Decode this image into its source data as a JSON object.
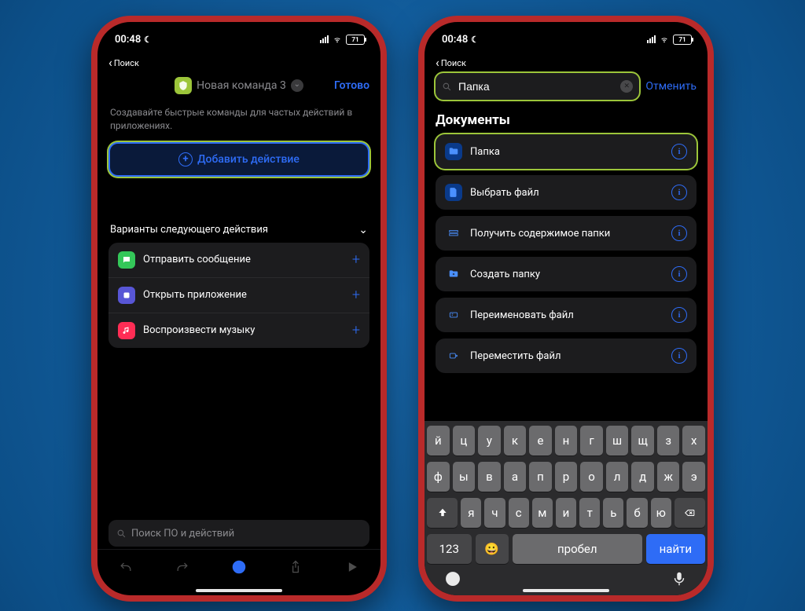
{
  "status": {
    "time": "00:48",
    "back": "Поиск",
    "battery": "71"
  },
  "left": {
    "shortcut_name": "Новая команда 3",
    "done": "Готово",
    "desc": "Создавайте быстрые команды для частых действий в приложениях.",
    "add_action": "Добавить действие",
    "next_variants": "Варианты следующего действия",
    "suggestions": [
      {
        "label": "Отправить сообщение"
      },
      {
        "label": "Открыть приложение"
      },
      {
        "label": "Воспроизвести музыку"
      }
    ],
    "search_placeholder": "Поиск ПО и действий"
  },
  "right": {
    "search_value": "Папка",
    "cancel": "Отменить",
    "section": "Документы",
    "results": [
      {
        "label": "Папка"
      },
      {
        "label": "Выбрать файл"
      },
      {
        "label": "Получить содержимое папки"
      },
      {
        "label": "Создать папку"
      },
      {
        "label": "Переименовать файл"
      },
      {
        "label": "Переместить файл"
      }
    ],
    "keyboard": {
      "row1": [
        "й",
        "ц",
        "у",
        "к",
        "е",
        "н",
        "г",
        "ш",
        "щ",
        "з",
        "х"
      ],
      "row2": [
        "ф",
        "ы",
        "в",
        "а",
        "п",
        "р",
        "о",
        "л",
        "д",
        "ж",
        "э"
      ],
      "row3": [
        "я",
        "ч",
        "с",
        "м",
        "и",
        "т",
        "ь",
        "б",
        "ю"
      ],
      "numbers": "123",
      "space": "Пробел",
      "find": "Найти"
    }
  }
}
